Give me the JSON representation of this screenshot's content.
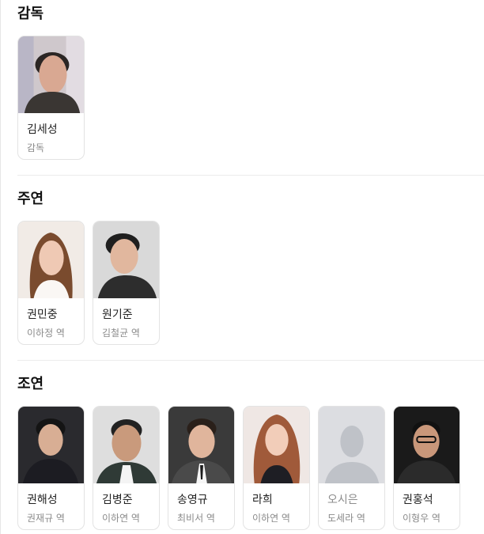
{
  "sections": [
    {
      "title": "감독",
      "people": [
        {
          "name": "김세성",
          "role": "감독",
          "photo": "person-photo"
        }
      ]
    },
    {
      "title": "주연",
      "people": [
        {
          "name": "권민중",
          "role": "이하정 역",
          "photo": "person-photo"
        },
        {
          "name": "원기준",
          "role": "김철균 역",
          "photo": "person-photo"
        }
      ]
    },
    {
      "title": "조연",
      "people": [
        {
          "name": "권해성",
          "role": "권재규 역",
          "photo": "person-photo"
        },
        {
          "name": "김병준",
          "role": "이하연 역",
          "photo": "person-photo"
        },
        {
          "name": "송영규",
          "role": "최비서 역",
          "photo": "person-photo"
        },
        {
          "name": "라희",
          "role": "이하연 역",
          "photo": "person-photo"
        },
        {
          "name": "오시은",
          "role": "도세라 역",
          "photo": "default-avatar-placeholder"
        },
        {
          "name": "권홍석",
          "role": "이형우 역",
          "photo": "person-photo"
        }
      ]
    }
  ],
  "colors": {
    "card_border": "#e3e3e3",
    "role_text": "#8a8a8a",
    "placeholder_bg": "#dcdde1",
    "placeholder_silhouette": "#bfc2c8"
  }
}
